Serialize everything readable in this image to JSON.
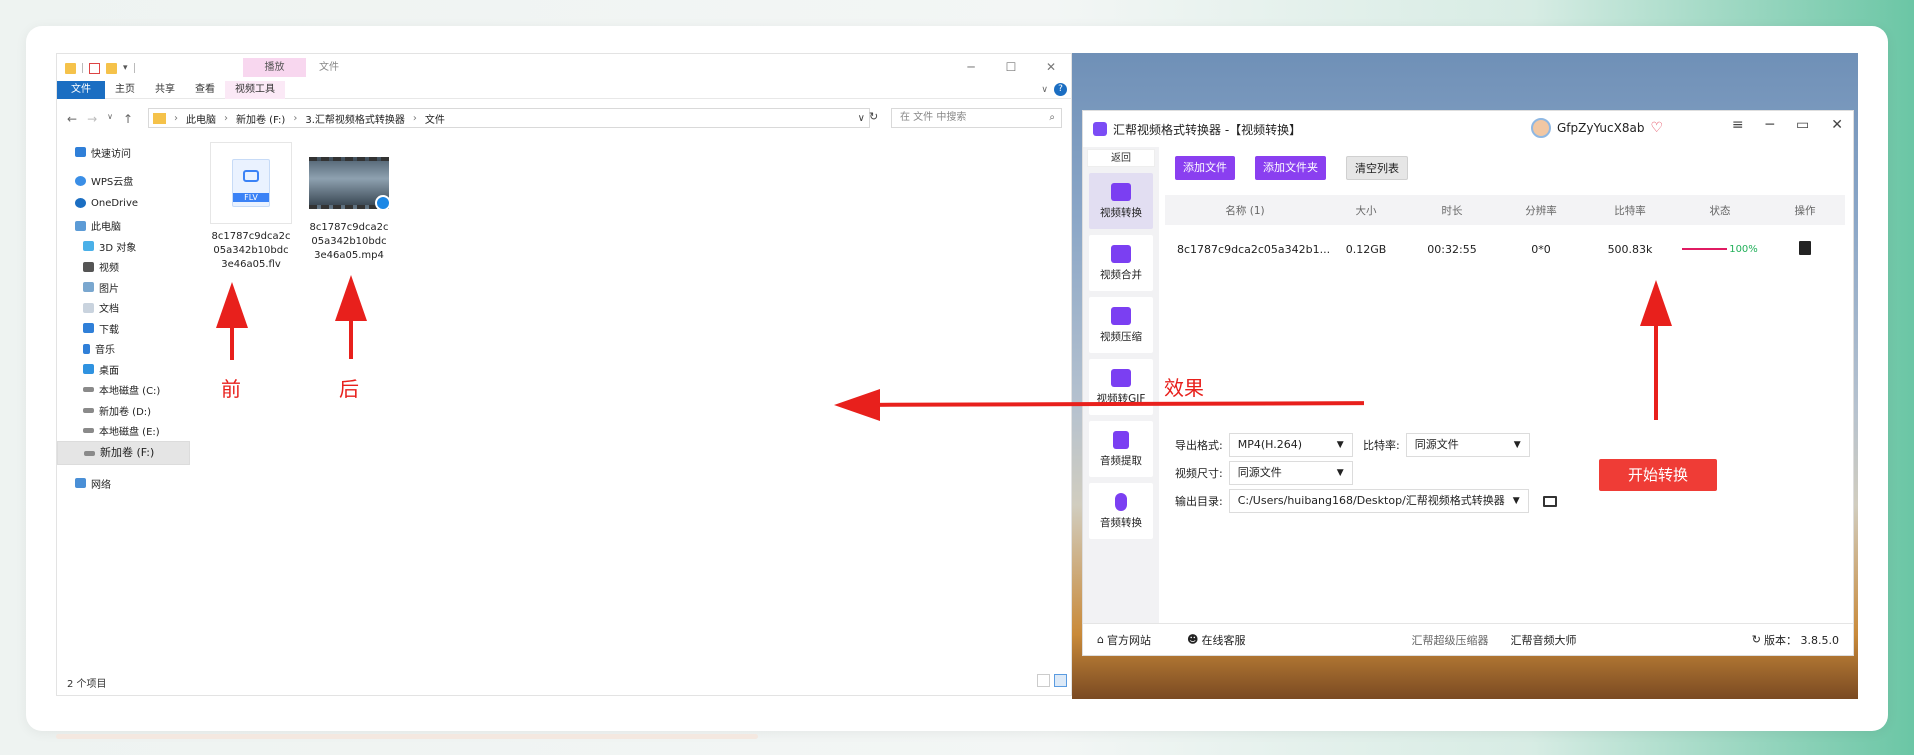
{
  "explorer": {
    "context_tab": "播放",
    "context_label": "文件",
    "ribbon_tabs": [
      "文件",
      "主页",
      "共享",
      "查看",
      "视频工具"
    ],
    "nav_back": "←",
    "nav_forward": "→",
    "nav_recent": "∨",
    "nav_up": "↑",
    "breadcrumb": [
      "此电脑",
      "新加卷 (F:)",
      "3.汇帮视频格式转换器",
      "文件"
    ],
    "search_placeholder": "在 文件 中搜索",
    "nav_items": [
      "快速访问",
      "WPS云盘",
      "OneDrive",
      "此电脑",
      "3D 对象",
      "视频",
      "图片",
      "文档",
      "下载",
      "音乐",
      "桌面",
      "本地磁盘 (C:)",
      "新加卷 (D:)",
      "本地磁盘 (E:)",
      "新加卷 (F:)",
      "网络"
    ],
    "files": [
      {
        "name": "8c1787c9dca2c05a342b10bdc3e46a05.flv",
        "badge": "FLV"
      },
      {
        "name": "8c1787c9dca2c05a342b10bdc3e46a05.mp4"
      }
    ],
    "status": "2 个项目"
  },
  "app": {
    "title": "汇帮视频格式转换器 -【视频转换】",
    "username": "GfpZyYucX8ab",
    "back_label": "返回",
    "sidebar": [
      "视频转换",
      "视频合并",
      "视频压缩",
      "视频转GIF",
      "音频提取",
      "音频转换"
    ],
    "toolbar": {
      "add_file": "添加文件",
      "add_folder": "添加文件夹",
      "clear_list": "清空列表"
    },
    "table": {
      "headers": [
        "名称 (1)",
        "大小",
        "时长",
        "分辨率",
        "比特率",
        "状态",
        "操作"
      ],
      "rows": [
        {
          "name": "8c1787c9dca2c05a342b1...",
          "size": "0.12GB",
          "duration": "00:32:55",
          "resolution": "0*0",
          "bitrate": "500.83k",
          "progress": 100,
          "progress_label": "100%"
        }
      ]
    },
    "settings": {
      "format_label": "导出格式:",
      "format_value": "MP4(H.264)",
      "bitrate_label": "比特率:",
      "bitrate_value": "同源文件",
      "size_label": "视频尺寸:",
      "size_value": "同源文件",
      "output_label": "输出目录:",
      "output_value": "C:/Users/huibang168/Desktop/汇帮视频格式转换器"
    },
    "start_button": "开始转换",
    "footer": {
      "site": "官方网站",
      "service": "在线客服",
      "compressor": "汇帮超级压缩器",
      "audio_master": "汇帮音频大师",
      "version": "版本： 3.8.5.0"
    }
  },
  "annotations": {
    "before": "前",
    "after": "后",
    "effect": "效果"
  },
  "colors": {
    "accent": "#8a3ff0",
    "start": "#ef3c36",
    "annotation": "#e8201c",
    "progress": "#e01b62",
    "explorer_tab": "#1b6ec2"
  }
}
